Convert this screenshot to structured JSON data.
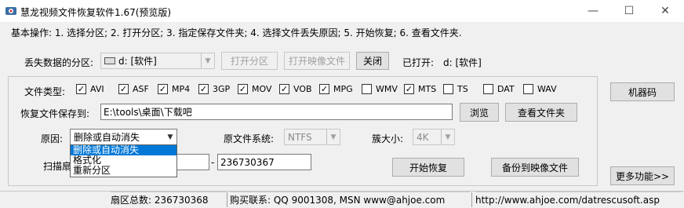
{
  "window": {
    "title": "慧龙视频文件恢复软件1.67(预览版)",
    "minimize_glyph": "—",
    "maximize_glyph": "☐",
    "close_glyph": "✕"
  },
  "steps_text": "基本操作: 1. 选择分区; 2. 打开分区; 3. 指定保存文件夹; 4. 选择文件丢失原因; 5. 开始恢复; 6. 查看文件夹.",
  "partition": {
    "label": "丢失数据的分区:",
    "selected": "d: [软件]",
    "open_partition_button": "打开分区",
    "open_image_button": "打开映像文件",
    "close_button": "关闭",
    "opened_label": "已打开:",
    "opened_value": "d: [软件]"
  },
  "machine_code_button": "机器码",
  "file_types": {
    "label": "文件类型:",
    "items": [
      {
        "name": "AVI",
        "checked": true
      },
      {
        "name": "ASF",
        "checked": true
      },
      {
        "name": "MP4",
        "checked": true
      },
      {
        "name": "3GP",
        "checked": true
      },
      {
        "name": "MOV",
        "checked": true
      },
      {
        "name": "VOB",
        "checked": true
      },
      {
        "name": "MPG",
        "checked": true
      },
      {
        "name": "WMV",
        "checked": false
      },
      {
        "name": "MTS",
        "checked": true
      },
      {
        "name": "TS",
        "checked": false
      },
      {
        "name": "DAT",
        "checked": false
      },
      {
        "name": "WAV",
        "checked": false
      }
    ]
  },
  "save_to": {
    "label": "恢复文件保存到:",
    "path": "E:\\tools\\桌面\\下载吧",
    "browse_button": "浏览",
    "view_folder_button": "查看文件夹"
  },
  "reason": {
    "label": "原因:",
    "selected": "删除或自动消失",
    "options": [
      "删除或自动消失",
      "格式化",
      "重新分区"
    ]
  },
  "original_fs": {
    "label": "原文件系统:",
    "selected": "NTFS"
  },
  "cluster_size": {
    "label": "簇大小:",
    "selected": "4K"
  },
  "scan_range": {
    "label": "扫描扇区",
    "end_value": "236730367",
    "dash": "-"
  },
  "start_recovery_button": "开始恢复",
  "backup_image_button": "备份到映像文件",
  "more_functions_button": "更多功能>>",
  "status_bar": {
    "sector_total": "扇区总数: 236730368",
    "contact": "购买联系: QQ 9001308, MSN www@ahjoe.com",
    "url": "http://www.ahjoe.com/datrescusoft.asp"
  }
}
